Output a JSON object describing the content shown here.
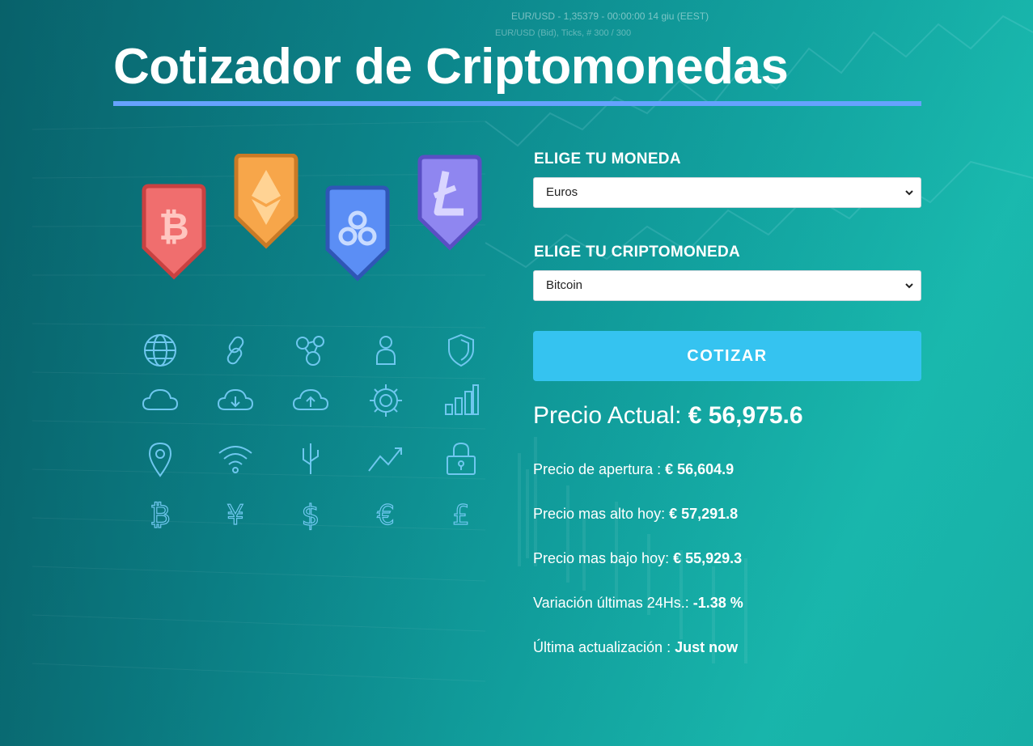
{
  "header": {
    "title": "Cotizador de Criptomonedas"
  },
  "form": {
    "currency_label": "ELIGE TU MONEDA",
    "currency_selected": "Euros",
    "crypto_label": "ELIGE TU CRIPTOMONEDA",
    "crypto_selected": "Bitcoin",
    "submit_label": "COTIZAR"
  },
  "result": {
    "current_label": "Precio Actual:",
    "current_value": "€ 56,975.6",
    "open_label": "Precio de apertura :",
    "open_value": "€ 56,604.9",
    "high_label": "Precio mas alto hoy:",
    "high_value": "€ 57,291.8",
    "low_label": "Precio mas bajo hoy:",
    "low_value": "€ 55,929.3",
    "change_label": "Variación últimas 24Hs.:",
    "change_value": "-1.38 %",
    "updated_label": "Última actualización :",
    "updated_value": "Just now"
  },
  "background_text": {
    "ticker": "EUR/USD - 1,35379 - 00:00:00  14 giu (EEST)",
    "ticks": "EUR/USD (Bid), Ticks, # 300 / 300"
  },
  "coins": [
    {
      "name": "bitcoin",
      "color": "#f06e6e",
      "border": "#c94141"
    },
    {
      "name": "ethereum",
      "color": "#f7a64a",
      "border": "#c97a26"
    },
    {
      "name": "ripple",
      "color": "#5b8ef5",
      "border": "#2f56b6"
    },
    {
      "name": "litecoin",
      "color": "#8f86f0",
      "border": "#5a4fc4"
    }
  ],
  "icon_grid": [
    "globe-icon",
    "link-icon",
    "network-icon",
    "user-icon",
    "shield-icon",
    "cloud-icon",
    "cloud-download-icon",
    "cloud-upload-icon",
    "gear-icon",
    "bar-chart-icon",
    "location-pin-icon",
    "wifi-icon",
    "usb-icon",
    "trend-up-icon",
    "padlock-icon",
    "bitcoin-symbol-icon",
    "yen-icon",
    "dollar-icon",
    "euro-icon",
    "pound-icon"
  ],
  "colors": {
    "accent_underline": "#66a2fe",
    "button": "#35c3f0",
    "icon_stroke": "#6fc7ef"
  }
}
